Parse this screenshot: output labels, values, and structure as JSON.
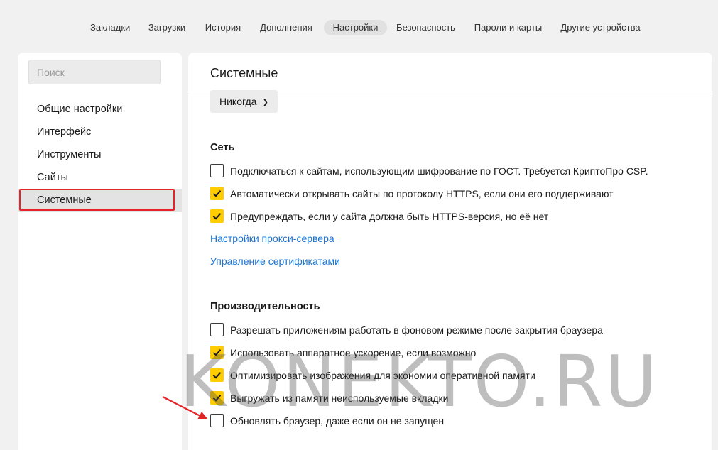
{
  "topnav": {
    "tabs": [
      {
        "label": "Закладки",
        "active": false
      },
      {
        "label": "Загрузки",
        "active": false
      },
      {
        "label": "История",
        "active": false
      },
      {
        "label": "Дополнения",
        "active": false
      },
      {
        "label": "Настройки",
        "active": true
      },
      {
        "label": "Безопасность",
        "active": false
      },
      {
        "label": "Пароли и карты",
        "active": false
      },
      {
        "label": "Другие устройства",
        "active": false
      }
    ]
  },
  "sidebar": {
    "search_placeholder": "Поиск",
    "items": [
      {
        "label": "Общие настройки",
        "active": false
      },
      {
        "label": "Интерфейс",
        "active": false
      },
      {
        "label": "Инструменты",
        "active": false
      },
      {
        "label": "Сайты",
        "active": false
      },
      {
        "label": "Системные",
        "active": true
      }
    ]
  },
  "main": {
    "title": "Системные",
    "dropdown_value": "Никогда",
    "sections": [
      {
        "title": "Сеть",
        "checkboxes": [
          {
            "label": "Подключаться к сайтам, использующим шифрование по ГОСТ. Требуется КриптоПро CSP.",
            "checked": false
          },
          {
            "label": "Автоматически открывать сайты по протоколу HTTPS, если они его поддерживают",
            "checked": true
          },
          {
            "label": "Предупреждать, если у сайта должна быть HTTPS-версия, но её нет",
            "checked": true
          }
        ],
        "links": [
          "Настройки прокси-сервера",
          "Управление сертификатами"
        ]
      },
      {
        "title": "Производительность",
        "checkboxes": [
          {
            "label": "Разрешать приложениям работать в фоновом режиме после закрытия браузера",
            "checked": false
          },
          {
            "label": "Использовать аппаратное ускорение, если возможно",
            "checked": true
          },
          {
            "label": "Оптимизировать изображения для экономии оперативной памяти",
            "checked": true
          },
          {
            "label": "Выгружать из памяти неиспользуемые вкладки",
            "checked": true
          },
          {
            "label": "Обновлять браузер, даже если он не запущен",
            "checked": false
          }
        ]
      }
    ]
  },
  "watermark": "KONEKTO.RU",
  "colors": {
    "checkbox_on": "#ffcc00",
    "link": "#1a73d1",
    "highlight": "#e4232b",
    "arrow": "#e4232b"
  }
}
